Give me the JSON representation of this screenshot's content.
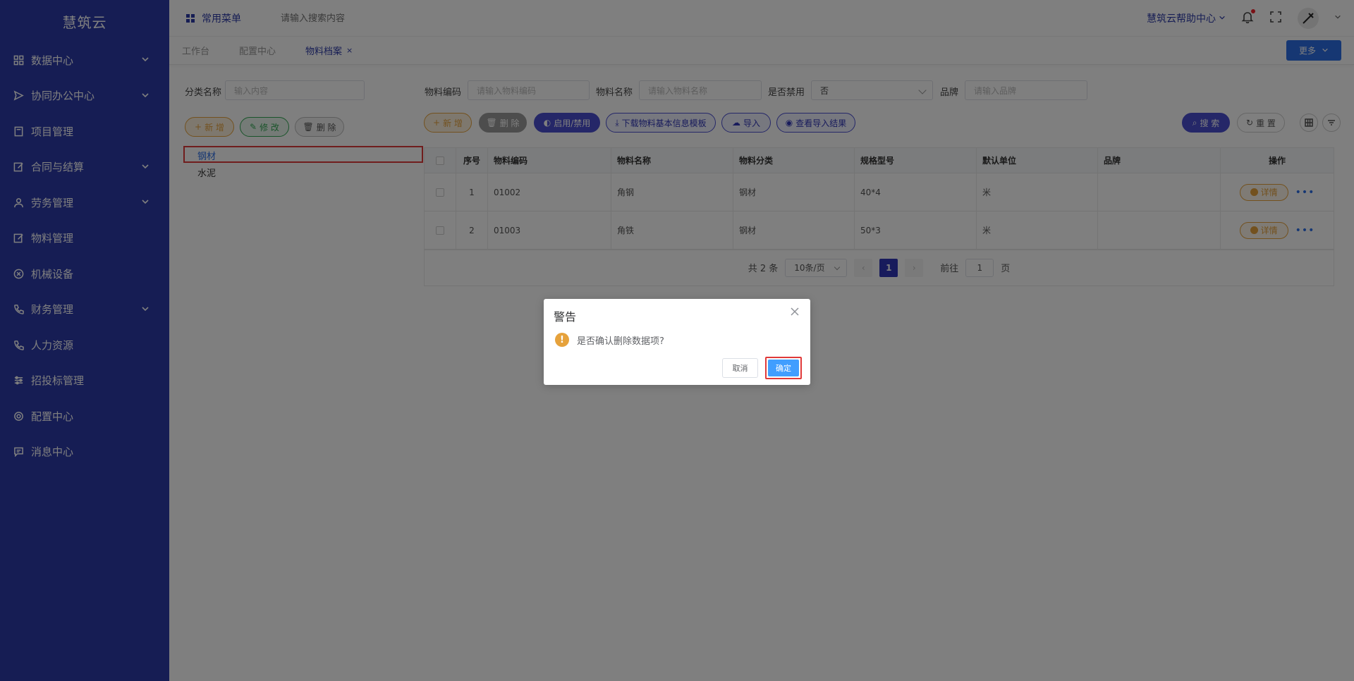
{
  "brand": "慧筑云",
  "sidebar": {
    "items": [
      {
        "label": "数据中心",
        "icon": "grid-icon",
        "has_children": true
      },
      {
        "label": "协同办公中心",
        "icon": "send-icon",
        "has_children": true
      },
      {
        "label": "项目管理",
        "icon": "book-icon",
        "has_children": false
      },
      {
        "label": "合同与结算",
        "icon": "edit-icon",
        "has_children": true
      },
      {
        "label": "劳务管理",
        "icon": "user-icon",
        "has_children": true
      },
      {
        "label": "物料管理",
        "icon": "edit-icon",
        "has_children": false
      },
      {
        "label": "机械设备",
        "icon": "circle-x-icon",
        "has_children": false
      },
      {
        "label": "财务管理",
        "icon": "phone-icon",
        "has_children": true
      },
      {
        "label": "人力资源",
        "icon": "phone-icon",
        "has_children": false
      },
      {
        "label": "招投标管理",
        "icon": "sliders-icon",
        "has_children": false
      },
      {
        "label": "配置中心",
        "icon": "gear-icon",
        "has_children": false
      },
      {
        "label": "消息中心",
        "icon": "message-icon",
        "has_children": false
      }
    ]
  },
  "topbar": {
    "common_menu": "常用菜单",
    "search_placeholder": "请输入搜索内容",
    "help": "慧筑云帮助中心"
  },
  "tabs": {
    "items": [
      {
        "label": "工作台"
      },
      {
        "label": "配置中心"
      },
      {
        "label": "物料档案",
        "closable": true
      }
    ],
    "close_glyph": "×",
    "more": "更多"
  },
  "filters": {
    "category_label": "分类名称",
    "category_placeholder": "输入内容",
    "code_label": "物料编码",
    "code_placeholder": "请输入物料编码",
    "name_label": "物料名称",
    "name_placeholder": "请输入物料名称",
    "disabled_label": "是否禁用",
    "disabled_value": "否",
    "brand_label": "品牌",
    "brand_placeholder": "请输入品牌"
  },
  "tree_actions": {
    "add": "新 增",
    "edit": "修 改",
    "delete": "删 除"
  },
  "tree": {
    "items": [
      "钢材",
      "水泥"
    ]
  },
  "table_actions": {
    "add": "新 增",
    "delete": "删 除",
    "toggle": "启用/禁用",
    "download": "下载物料基本信息模板",
    "import": "导入",
    "view_import": "查看导入结果",
    "search": "搜 索",
    "reset": "重 置"
  },
  "table": {
    "headers": [
      "序号",
      "物料编码",
      "物料名称",
      "物料分类",
      "规格型号",
      "默认单位",
      "品牌",
      "操作"
    ],
    "rows": [
      {
        "index": "1",
        "code": "01002",
        "name": "角钢",
        "category": "钢材",
        "spec": "40*4",
        "unit": "米",
        "brand": ""
      },
      {
        "index": "2",
        "code": "01003",
        "name": "角铁",
        "category": "钢材",
        "spec": "50*3",
        "unit": "米",
        "brand": ""
      }
    ],
    "detail_label": "详情",
    "more_glyph": "•••"
  },
  "pagination": {
    "total": "共 2 条",
    "page_size": "10条/页",
    "current": "1",
    "goto_label": "前往",
    "goto_value": "1",
    "page_suffix": "页"
  },
  "dialog": {
    "title": "警告",
    "message": "是否确认删除数据项?",
    "cancel": "取消",
    "confirm": "确定",
    "warn_glyph": "!"
  },
  "colors": {
    "sidebar": "#2c3aa8",
    "primary": "#409eff",
    "warning": "#e6a23c",
    "highlight_border": "#e03a3a"
  }
}
